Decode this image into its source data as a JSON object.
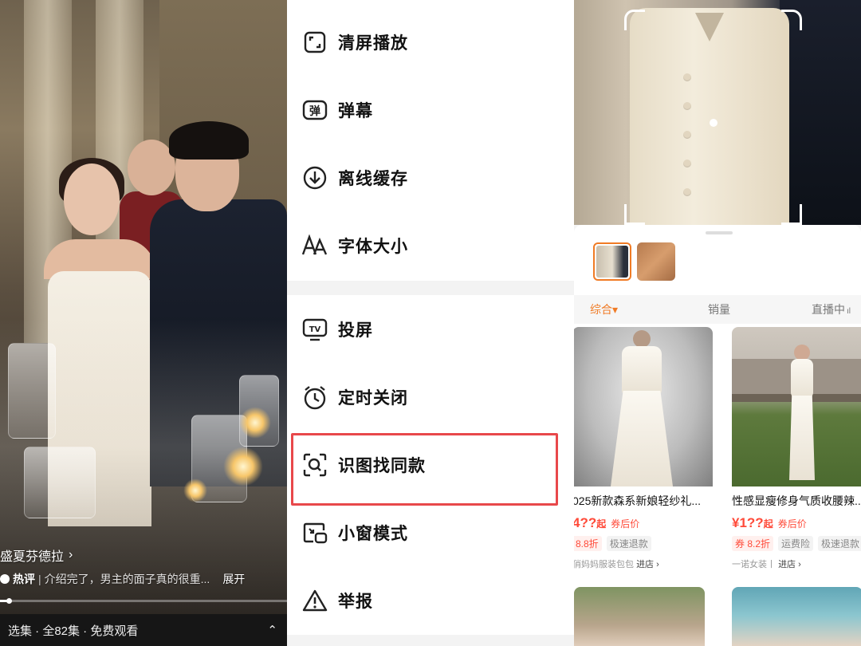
{
  "video": {
    "title": "盛夏芬德拉",
    "title_chevron": "›",
    "hot_label": "热评",
    "comment_separator": "|",
    "comment_text": "介绍完了，男主的面子真的很重...",
    "expand_label": "展开",
    "progress_fraction": 0.03,
    "episodes_label": "选集 · 全82集 · 免费观看",
    "episodes_chevron": "⌃"
  },
  "menu": {
    "items": [
      {
        "label": "清屏播放",
        "icon": "clear-screen-icon"
      },
      {
        "label": "弹幕",
        "icon": "danmaku-icon"
      },
      {
        "label": "离线缓存",
        "icon": "download-icon"
      },
      {
        "label": "字体大小",
        "icon": "font-size-icon"
      },
      {
        "label": "投屏",
        "icon": "tv-cast-icon"
      },
      {
        "label": "定时关闭",
        "icon": "alarm-clock-icon"
      },
      {
        "label": "识图找同款",
        "icon": "image-search-icon"
      },
      {
        "label": "小窗模式",
        "icon": "picture-in-picture-icon"
      },
      {
        "label": "举报",
        "icon": "warning-icon"
      }
    ],
    "highlight_color": "#e8484b"
  },
  "shop": {
    "back_chevron": "‹",
    "sort_tabs": [
      "综合▾",
      "销量",
      "直播中"
    ],
    "accent_color": "#f07b25",
    "products": [
      {
        "title": "025新款森系新娘轻纱礼...",
        "price": "4??",
        "price_suffix": "起",
        "after_coupon": "券后价",
        "tags": [
          "8.8折",
          "极速退款"
        ],
        "shop": "俏妈妈服装包包",
        "enter": "进店 ›"
      },
      {
        "title": "性感显瘦修身气质收腰辣...",
        "price": "¥1??",
        "price_suffix": "起",
        "after_coupon": "券后价",
        "tags": [
          "券  8.2折",
          "运费险",
          "极速退款"
        ],
        "shop": "一诺女装丨",
        "enter": "进店 ›"
      }
    ],
    "price_color": "#ff4b3a"
  }
}
